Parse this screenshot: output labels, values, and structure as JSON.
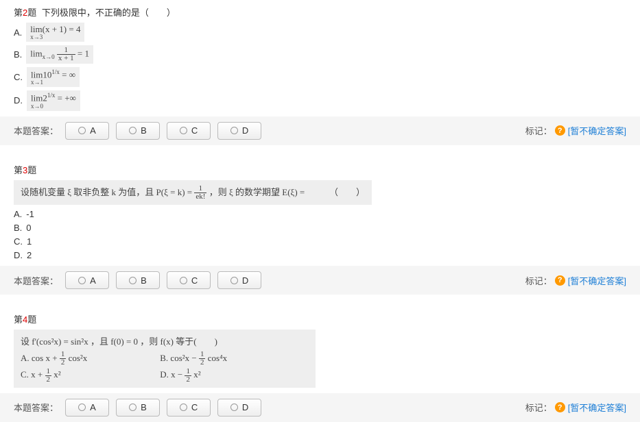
{
  "common": {
    "q_prefix": "第",
    "q_suffix": "题",
    "answer_label": "本题答案：",
    "mark_label": "标记：",
    "help_char": "?",
    "unsure_text": "[暂不确定答案]",
    "buttons": [
      "A",
      "B",
      "C",
      "D"
    ]
  },
  "q2": {
    "num": "2",
    "stem_inline": "下列极限中，不正确的是（　　）",
    "optA_letter": "A.",
    "optA_math": "lim(x + 1) = 4",
    "optA_sub": "x→3",
    "optB_letter": "B.",
    "optB_pre": "lim",
    "optB_sub": "x→0",
    "optB_frac_num": "1",
    "optB_frac_den": "x + 1",
    "optB_post": " = 1",
    "optC_letter": "C.",
    "optC_math_a": "lim10",
    "optC_sub": "x→1",
    "optC_sup": "1/x",
    "optC_math_b": " = ∞",
    "optD_letter": "D.",
    "optD_math_a": "lim2",
    "optD_sub": "x→0",
    "optD_sup": "1/x",
    "optD_math_b": " = +∞"
  },
  "q3": {
    "num": "3",
    "stem_pre": "设随机变量 ξ 取非负整 k 为值，且 P(ξ = k) = ",
    "stem_frac_num": "1",
    "stem_frac_den": "ek!",
    "stem_post": " ，则 ξ 的数学期望 E(ξ) = 　　　（　　）",
    "optA_letter": "A.",
    "optA_text": "-1",
    "optB_letter": "B.",
    "optB_text": "0",
    "optC_letter": "C.",
    "optC_text": "1",
    "optD_letter": "D.",
    "optD_text": "2"
  },
  "q4": {
    "num": "4",
    "stem": "设 f'(cos²x) = sin²x ，且 f(0) = 0 ，则 f(x) 等于(　　)",
    "rowA_label": "A. ",
    "rowA_pre": "cos x + ",
    "rowA_frac_num": "1",
    "rowA_frac_den": "2",
    "rowA_post": " cos²x",
    "rowB_label": "B. ",
    "rowB_pre": "cos²x − ",
    "rowB_frac_num": "1",
    "rowB_frac_den": "2",
    "rowB_post": " cos⁴x",
    "rowC_label": "C. ",
    "rowC_pre": "x + ",
    "rowC_frac_num": "1",
    "rowC_frac_den": "2",
    "rowC_post": " x²",
    "rowD_label": "D. ",
    "rowD_pre": "x − ",
    "rowD_frac_num": "1",
    "rowD_frac_den": "2",
    "rowD_post": " x²"
  }
}
